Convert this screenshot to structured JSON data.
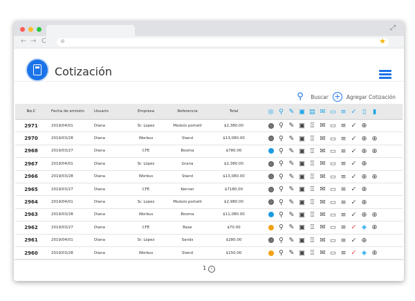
{
  "browser": {
    "expand_icon": "expand-icon",
    "back": "←",
    "forward": "→",
    "reload": "C",
    "globe": "globe-icon",
    "star": "★"
  },
  "app": {
    "title": "Cotización",
    "accent": "#1a73e8"
  },
  "actions": {
    "search_label": "Buscar",
    "add_label": "Agregar Cotización"
  },
  "table": {
    "headers": {
      "no": "No.C",
      "fecha": "Fecha de emisión",
      "usuario": "Usuario",
      "empresa": "Empresa",
      "referencia": "Referencia",
      "total": "Total"
    },
    "rows": [
      {
        "no": "2971",
        "fecha": "2019/04/01",
        "usuario": "Diana",
        "empresa": "Sr. Lopez",
        "referencia": "Modulo portatil",
        "total": "$2,380.00",
        "status": "gray",
        "approved": false
      },
      {
        "no": "2970",
        "fecha": "2019/03/28",
        "usuario": "Diana",
        "empresa": "Worbus",
        "referencia": "Stand",
        "total": "$13,080.00",
        "status": "gray",
        "approved": false
      },
      {
        "no": "2968",
        "fecha": "2019/03/27",
        "usuario": "Diana",
        "empresa": "CFE",
        "referencia": "Booma",
        "total": "$780.00",
        "status": "blue",
        "approved": false
      },
      {
        "no": "2967",
        "fecha": "2019/04/01",
        "usuario": "Diana",
        "empresa": "Sr. López",
        "referencia": "Grana",
        "total": "$2,380.00",
        "status": "gray",
        "approved": false
      },
      {
        "no": "2966",
        "fecha": "2019/03/28",
        "usuario": "Diana",
        "empresa": "Worbus",
        "referencia": "Stand",
        "total": "$13,080.00",
        "status": "gray",
        "approved": false
      },
      {
        "no": "2965",
        "fecha": "2019/03/27",
        "usuario": "Diana",
        "empresa": "CFE",
        "referencia": "Kenner",
        "total": "$7180.00",
        "status": "gray",
        "approved": false
      },
      {
        "no": "2964",
        "fecha": "2019/04/01",
        "usuario": "Diana",
        "empresa": "Sr. Lopez",
        "referencia": "Modulo portatil",
        "total": "$2,980.00",
        "status": "gray",
        "approved": false
      },
      {
        "no": "2963",
        "fecha": "2019/03/28",
        "usuario": "Diana",
        "empresa": "Worbus",
        "referencia": "Booma",
        "total": "$11,080.00",
        "status": "blue",
        "approved": false
      },
      {
        "no": "2962",
        "fecha": "2019/03/27",
        "usuario": "Diana",
        "empresa": "CFE",
        "referencia": "Base",
        "total": "$70.00",
        "status": "orange",
        "approved": true
      },
      {
        "no": "2961",
        "fecha": "2019/04/01",
        "usuario": "Diana",
        "empresa": "Sr. López",
        "referencia": "Sands",
        "total": "$280.00",
        "status": "gray",
        "approved": false
      },
      {
        "no": "2960",
        "fecha": "2019/03/28",
        "usuario": "Diana",
        "empresa": "Worbus",
        "referencia": "Stand",
        "total": "$150.00",
        "status": "orange",
        "approved": true
      }
    ]
  },
  "pagination": {
    "page": "1"
  }
}
